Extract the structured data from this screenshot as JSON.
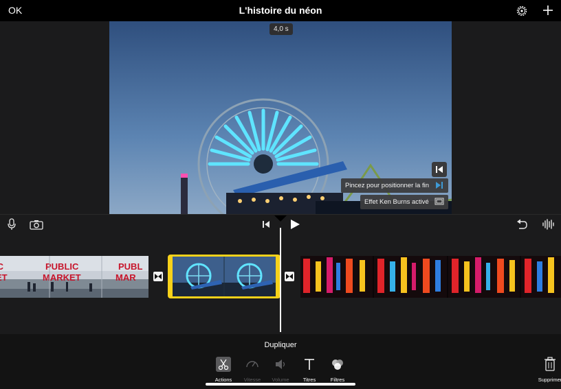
{
  "header": {
    "ok_label": "OK",
    "title": "L'histoire du néon",
    "settings_icon": "gear-icon",
    "add_icon": "plus-icon"
  },
  "viewer": {
    "duration": "4,0 s",
    "tooltip_position_end": "Pincez pour positionner la fin",
    "tooltip_ken_burns": "Effet Ken Burns activé"
  },
  "controls": {
    "icons": [
      "microphone-icon",
      "camera-icon",
      "skip-back-icon",
      "play-icon",
      "undo-icon",
      "waveform-icon"
    ]
  },
  "timeline": {
    "clips": [
      {
        "name": "Pike Place Market",
        "sign_line1": "PUBLIC",
        "sign_line2": "MARKET"
      },
      {
        "name": "Ferris wheel",
        "selected": true
      },
      {
        "name": "Neon signs"
      }
    ]
  },
  "toolbar": {
    "action_title": "Dupliquer",
    "tools": [
      {
        "label": "Actions",
        "state": "active",
        "icon": "scissors-icon"
      },
      {
        "label": "Vitesse",
        "state": "disabled",
        "icon": "speedometer-icon"
      },
      {
        "label": "Volume",
        "state": "disabled",
        "icon": "speaker-icon"
      },
      {
        "label": "Titres",
        "state": "enabled",
        "icon": "text-icon"
      },
      {
        "label": "Filtres",
        "state": "enabled",
        "icon": "filters-icon"
      }
    ],
    "delete_label": "Supprimer"
  },
  "colors": {
    "selection": "#f7d21a",
    "accent_blue": "#3e9ad6",
    "background": "#1b1b1c"
  }
}
